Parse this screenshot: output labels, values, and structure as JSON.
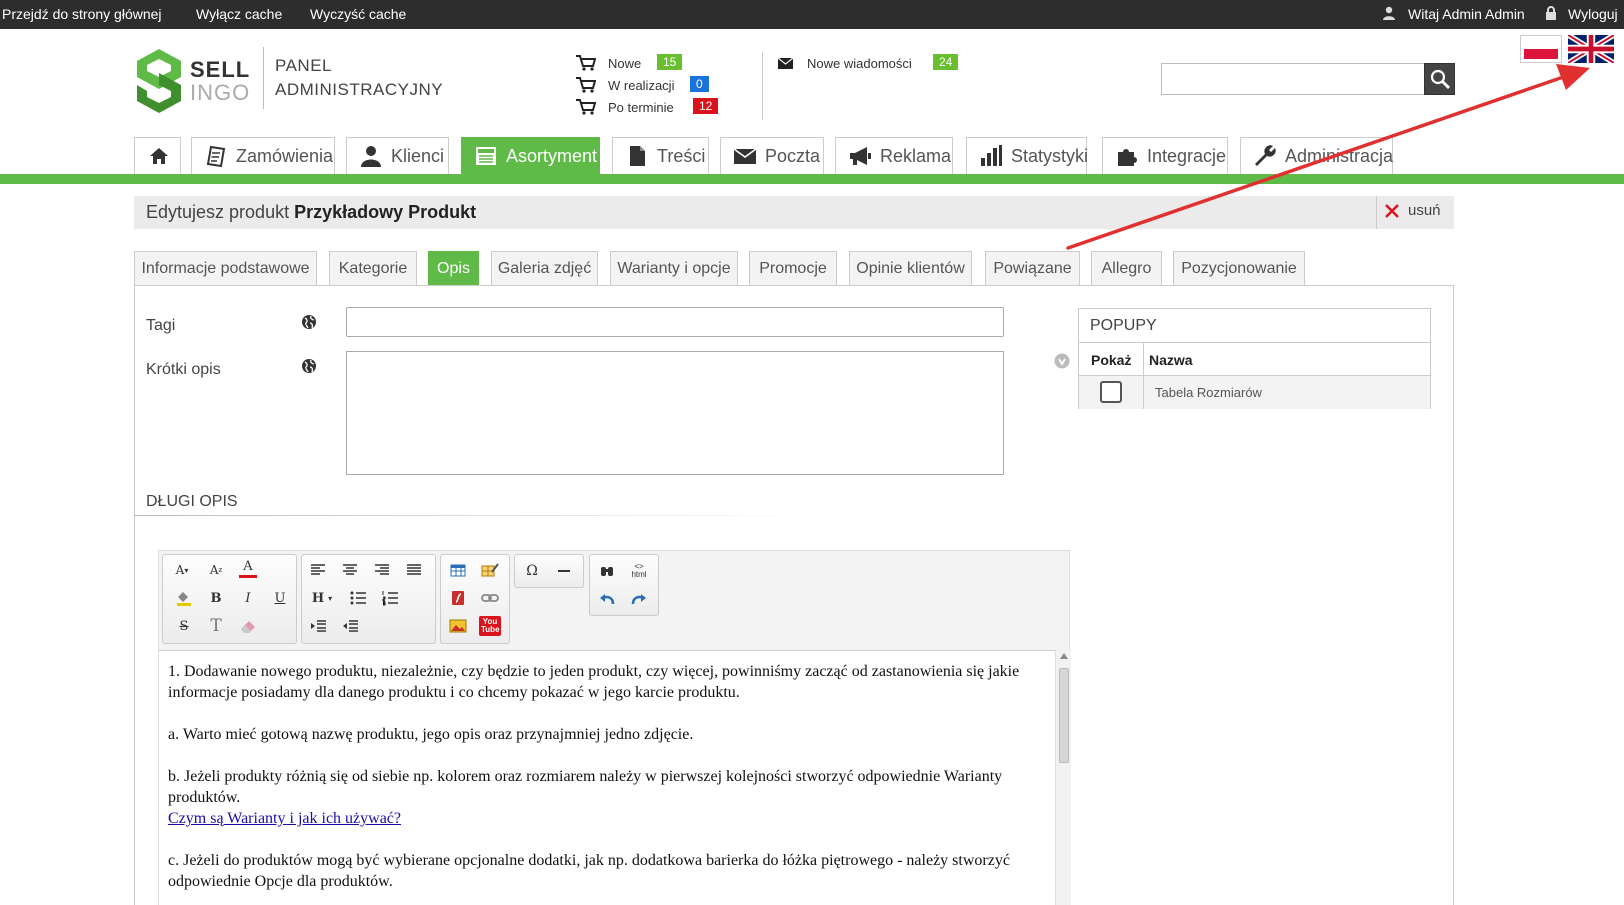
{
  "topbar": {
    "home_link": "Przejdź do strony głównej",
    "disable_cache": "Wyłącz cache",
    "clear_cache": "Wyczyść cache",
    "welcome": "Witaj Admin Admin",
    "logout": "Wyloguj"
  },
  "logo": {
    "line1": "SELL",
    "line2": "INGO"
  },
  "panel": {
    "line1": "PANEL",
    "line2": "ADMINISTRACYJNY"
  },
  "orders": [
    {
      "label": "Nowe",
      "count": "15",
      "color": "#6abf2f"
    },
    {
      "label": "W realizacji",
      "count": "0",
      "color": "#1a73d9"
    },
    {
      "label": "Po terminie",
      "count": "12",
      "color": "#d9121b"
    }
  ],
  "messages": {
    "label": "Nowe wiadomości",
    "count": "24",
    "color": "#6abf2f"
  },
  "search": {
    "value": ""
  },
  "nav": [
    {
      "label": "",
      "icon": "home-icon"
    },
    {
      "label": "Zamówienia",
      "icon": "orders-icon"
    },
    {
      "label": "Klienci",
      "icon": "user-icon"
    },
    {
      "label": "Asortyment",
      "icon": "catalog-icon"
    },
    {
      "label": "Treści",
      "icon": "document-icon"
    },
    {
      "label": "Poczta",
      "icon": "mail-icon"
    },
    {
      "label": "Reklama",
      "icon": "megaphone-icon"
    },
    {
      "label": "Statystyki",
      "icon": "bar-chart-icon"
    },
    {
      "label": "Integracje",
      "icon": "puzzle-icon"
    },
    {
      "label": "Administracja",
      "icon": "wrench-icon"
    }
  ],
  "edit": {
    "prefix": "Edytujesz produkt",
    "product": "Przykładowy Produkt",
    "delete": "usuń"
  },
  "subtabs": [
    "Informacje podstawowe",
    "Kategorie",
    "Opis",
    "Galeria zdjęć",
    "Warianty i opcje",
    "Promocje",
    "Opinie klientów",
    "Powiązane",
    "Allegro",
    "Pozycjonowanie"
  ],
  "form": {
    "tags_label": "Tagi",
    "tags_value": "",
    "short_label": "Krótki opis",
    "short_value": "",
    "long_label": "DŁUGI OPIS"
  },
  "popups": {
    "title": "POPUPY",
    "col_show": "Pokaż",
    "col_name": "Nazwa",
    "row_name": "Tabela Rozmiarów",
    "row_checked": false
  },
  "editor": {
    "p1": "1. Dodawanie nowego produktu, niezależnie, czy będzie to jeden produkt, czy więcej, powinniśmy zacząć od zastanowienia się jakie informacje posiadamy dla danego produktu i co chcemy pokazać w jego karcie produktu.",
    "p2": "a. Warto mieć gotową nazwę produktu, jego opis oraz przynajmniej jedno zdjęcie.",
    "p3": "b. Jeżeli produkty różnią się od siebie np. kolorem oraz rozmiarem należy w pierwszej kolejności stworzyć odpowiednie Warianty produktów.",
    "p3_link": "Czym są Warianty i jak ich używać?",
    "p4": "c. Jeżeli do produktów mogą być wybierane opcjonalne dodatki, jak np. dodatkowa barierka do łóżka piętrowego - należy stworzyć odpowiednie Opcje dla produktów.",
    "btn_font_size": "A",
    "btn_superscript": "A",
    "btn_font_color": "A",
    "btn_bold": "B",
    "btn_italic": "I",
    "btn_underline": "U",
    "btn_strike": "S",
    "btn_text_format": "T",
    "btn_heading": "H",
    "btn_omega": "Ω",
    "btn_html": "html",
    "btn_youtube": "You Tube"
  },
  "colors": {
    "accent": "#5fba47",
    "topbar": "#2d2d2d",
    "arrow": "#e03030"
  }
}
